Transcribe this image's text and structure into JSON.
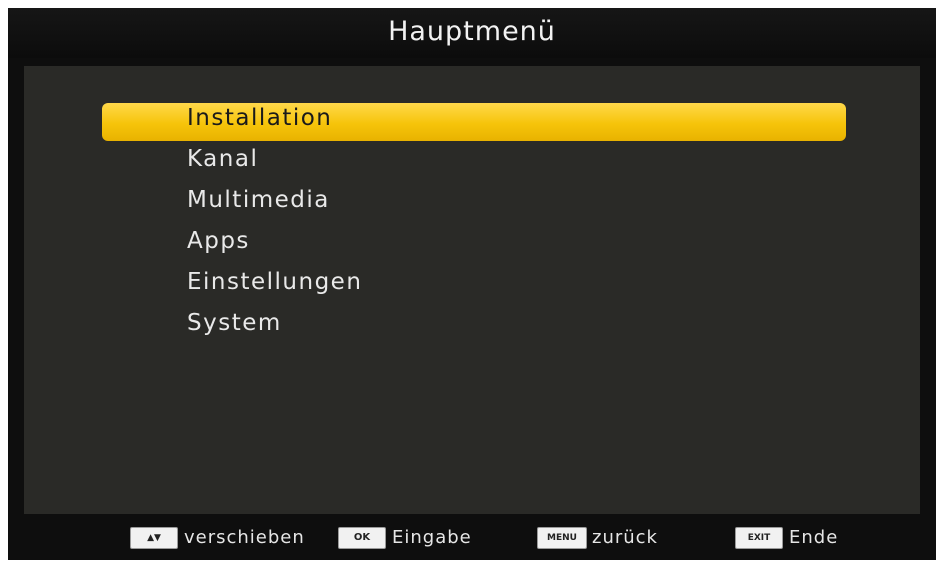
{
  "header": {
    "title": "Hauptmenü"
  },
  "menu": {
    "selected_index": 0,
    "items": [
      {
        "label": "Installation"
      },
      {
        "label": "Kanal"
      },
      {
        "label": "Multimedia"
      },
      {
        "label": "Apps"
      },
      {
        "label": "Einstellungen"
      },
      {
        "label": "System"
      }
    ]
  },
  "footer": {
    "hints": [
      {
        "key": "▲▼",
        "label": "verschieben",
        "icon": "up-down-arrows-icon"
      },
      {
        "key": "OK",
        "label": "Eingabe",
        "icon": "ok-key-icon"
      },
      {
        "key": "MENU",
        "label": "zurück",
        "icon": "menu-key-icon"
      },
      {
        "key": "EXIT",
        "label": "Ende",
        "icon": "exit-key-icon"
      }
    ]
  },
  "colors": {
    "highlight": "#f6c40a",
    "panel": "#2a2a27",
    "background": "#0e0e0e",
    "text": "#e9e9e9"
  }
}
